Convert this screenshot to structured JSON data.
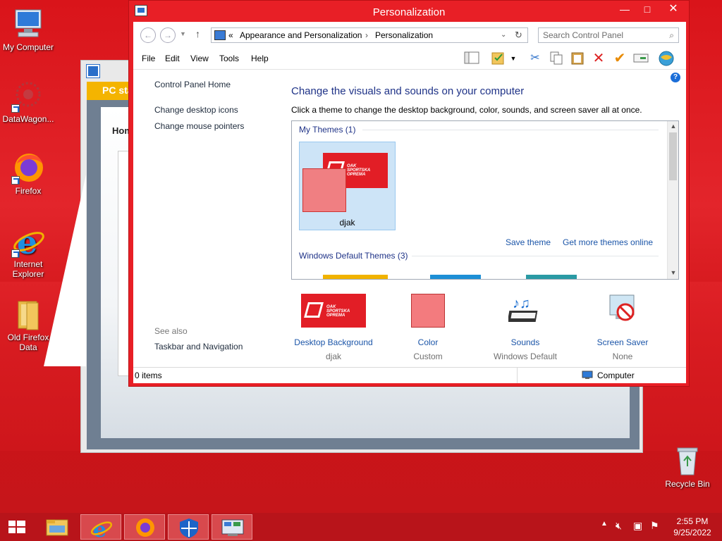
{
  "desktop": {
    "icons": [
      {
        "label": "My Computer",
        "icon": "computer-icon"
      },
      {
        "label": "DataWagon...",
        "icon": "datawagon-icon"
      },
      {
        "label": "Firefox",
        "icon": "firefox-icon"
      },
      {
        "label": "Internet Explorer",
        "icon": "ie-icon"
      },
      {
        "label": "Old Firefox Data",
        "icon": "folder-icon"
      },
      {
        "label": "Recycle Bin",
        "icon": "recycle-bin-icon"
      }
    ]
  },
  "background_window": {
    "tab_label": "PC sta",
    "home_label": "Hom"
  },
  "window": {
    "title": "Personalization",
    "controls": {
      "minimize": "—",
      "maximize": "□",
      "close": "✕"
    }
  },
  "address": {
    "prefix": "«",
    "crumb1": "Appearance and Personalization",
    "separator": "›",
    "crumb2": "Personalization",
    "search_placeholder": "Search Control Panel"
  },
  "menu": [
    "File",
    "Edit",
    "View",
    "Tools",
    "Help"
  ],
  "left_nav": {
    "home": "Control Panel Home",
    "links": [
      "Change desktop icons",
      "Change mouse pointers"
    ],
    "see_also": "See also",
    "see_also_links": [
      "Taskbar and Navigation"
    ]
  },
  "content": {
    "heading": "Change the visuals and sounds on your computer",
    "subtext": "Click a theme to change the desktop background, color, sounds, and screen saver all at once.",
    "my_themes": "My Themes (1)",
    "theme_name": "djak",
    "logo_text": [
      "OAK",
      "SPORTSKA",
      "OPREMA"
    ],
    "save_theme": "Save theme",
    "get_more": "Get more themes online",
    "default_themes": "Windows Default Themes (3)"
  },
  "options": [
    {
      "label": "Desktop Background",
      "value": "djak"
    },
    {
      "label": "Color",
      "value": "Custom"
    },
    {
      "label": "Sounds",
      "value": "Windows Default"
    },
    {
      "label": "Screen Saver",
      "value": "None"
    }
  ],
  "status": {
    "items": "0 items",
    "location": "Computer"
  },
  "taskbar": {
    "time": "2:55 PM",
    "date": "9/25/2022"
  },
  "colors": {
    "accent": "#e81f26",
    "link": "#1b55a8",
    "heading": "#1e3287"
  }
}
